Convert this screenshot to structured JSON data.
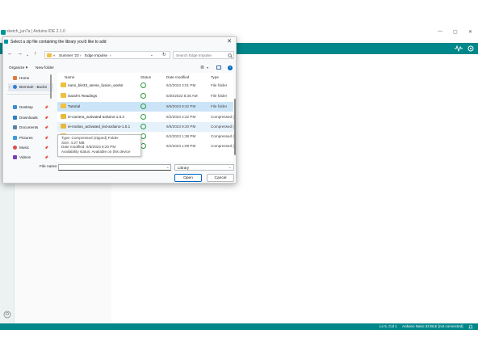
{
  "ide": {
    "window_title": "sketch_jun7a | Arduino IDE 2.1.0",
    "controls": {
      "minimize": "—",
      "maximize": "▢",
      "close": "✕"
    },
    "status": {
      "position": "Ln 5, Col 1",
      "board": "Arduino Nano 33 BLE [not connected]"
    },
    "accent": "#00878a"
  },
  "dialog": {
    "title": "Select a zip file containing the library you'd like to add",
    "close": "✕",
    "address": {
      "root": "«",
      "crumbs": [
        "Summer '23",
        "Edge Impulse"
      ],
      "sep": "›"
    },
    "search": {
      "placeholder": "Search Edge Impulse"
    },
    "commands": {
      "organize": "Organize ▾",
      "new_folder": "New folder"
    },
    "nav_items": [
      {
        "label": "Home",
        "icon": "home-icon"
      },
      {
        "label": "Brennah - Buckn",
        "icon": "cloud-icon"
      },
      {
        "label": "Desktop",
        "icon": "desktop-icon"
      },
      {
        "label": "Downloads",
        "icon": "download-icon"
      },
      {
        "label": "Documents",
        "icon": "documents-icon"
      },
      {
        "label": "Pictures",
        "icon": "pictures-icon"
      },
      {
        "label": "Music",
        "icon": "music-icon"
      },
      {
        "label": "Videos",
        "icon": "videos-icon"
      }
    ],
    "columns": {
      "name": "Name",
      "status": "Status",
      "date": "Date modified",
      "type": "Type"
    },
    "files": [
      {
        "name": "nano_ble33_sense_fusion_works",
        "date": "6/2/2023 3:01 PM",
        "type": "File folder",
        "kind": "folder"
      },
      {
        "name": "Sarah's Readings",
        "date": "5/30/2023 8:36 AM",
        "type": "File folder",
        "kind": "folder"
      },
      {
        "name": "Tutorial",
        "date": "6/6/2023 9:42 PM",
        "type": "File folder",
        "kind": "folder"
      },
      {
        "name": "ei-camera_activated-arduino-1.0.2",
        "date": "6/2/2023 4:22 PM",
        "type": "Compressed (",
        "kind": "zip"
      },
      {
        "name": "ei-motion_activated_led-arduino-1.0.1",
        "date": "6/6/2023 9:20 PM",
        "type": "Compressed (",
        "kind": "zip"
      },
      {
        "name": "",
        "date": "6/2/2023 1:38 PM",
        "type": "Compressed (",
        "kind": "zip"
      },
      {
        "name": "",
        "date": "6/2/2023 1:09 PM",
        "type": "Compressed (",
        "kind": "zip"
      }
    ],
    "tooltip": [
      "Type: Compressed (zipped) Folder",
      "Size: 4.27 MB",
      "Date modified: 6/6/2023 9:20 PM",
      "Availability status: Available on this device"
    ],
    "footer": {
      "file_name_label": "File name:",
      "file_name_value": "",
      "file_type": "Library",
      "open": "Open",
      "cancel": "Cancel"
    }
  }
}
